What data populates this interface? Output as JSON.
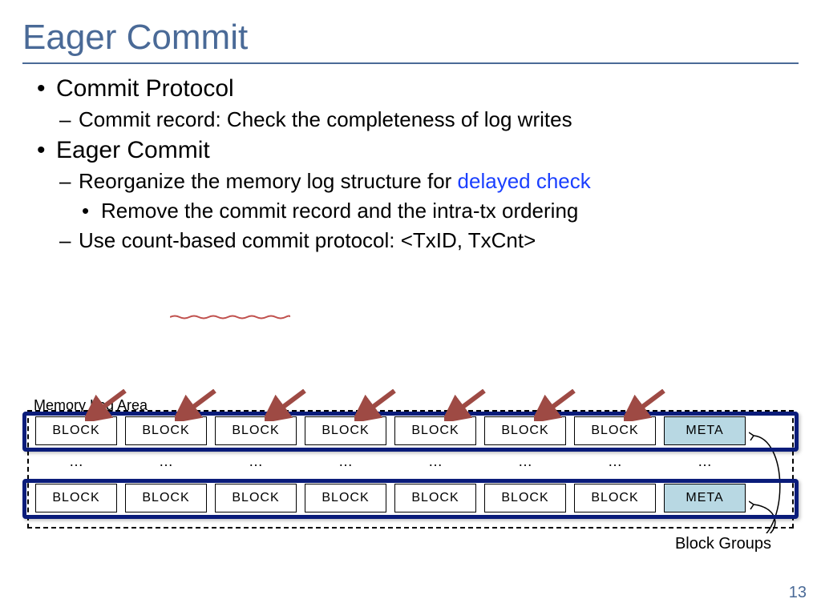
{
  "title": "Eager Commit",
  "bullets": {
    "b1": "Commit Protocol",
    "b1a": "Commit record: Check the completeness of log writes",
    "b2": "Eager Commit",
    "b2a_pre": "Reorganize the memory log structure for ",
    "b2a_hl": "delayed check",
    "b2a_sub": "Remove the commit record and the intra-tx ordering",
    "b2b": "Use count-based commit protocol: <TxID, TxCnt>"
  },
  "diagram": {
    "memory_log_area": "Memory Log Area",
    "block": "BLOCK",
    "meta": "META",
    "dots": "…",
    "block_groups": "Block Groups"
  },
  "page": "13"
}
